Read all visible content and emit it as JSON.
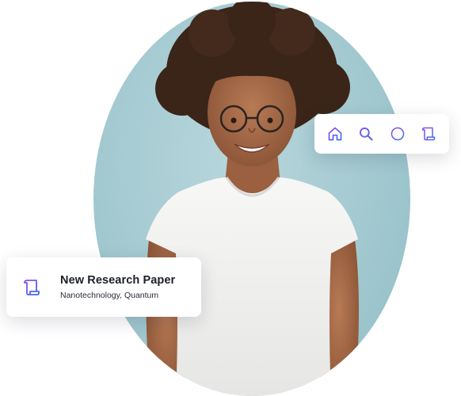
{
  "paper_card": {
    "title": "New Research Paper",
    "subtitle": "Nanotechnology, Quantum",
    "icon": "scroll-document-icon"
  },
  "toolbar": {
    "items": [
      {
        "icon": "home-icon"
      },
      {
        "icon": "search-icon"
      },
      {
        "icon": "add-circle-icon"
      },
      {
        "icon": "scroll-document-icon"
      }
    ]
  },
  "colors": {
    "icon_gradient_start": "#8a4bf0",
    "icon_gradient_end": "#3f6fe8",
    "photo_background": "#a3c9d0",
    "card_background": "#ffffff",
    "title_text": "#1c1f2a"
  }
}
